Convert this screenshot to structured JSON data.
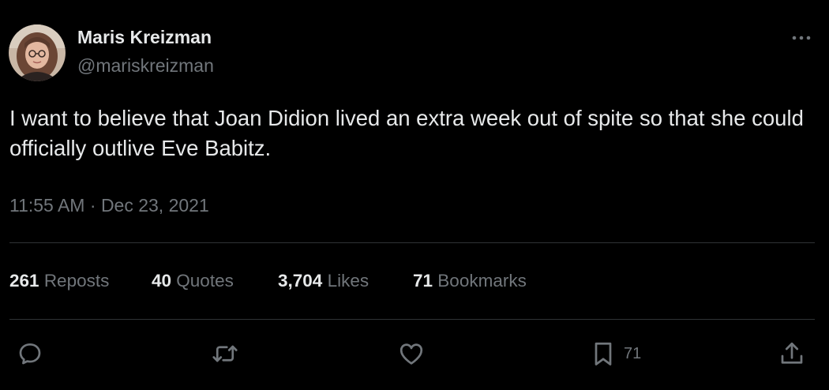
{
  "tweet": {
    "author": {
      "name": "Maris Kreizman",
      "handle": "@mariskreizman"
    },
    "text": "I want to believe that Joan Didion lived an extra week out of spite so that she could officially outlive Eve Babitz.",
    "time": "11:55 AM",
    "separator": "·",
    "date": "Dec 23, 2021"
  },
  "stats": [
    {
      "value": "261",
      "label": "Reposts"
    },
    {
      "value": "40",
      "label": "Quotes"
    },
    {
      "value": "3,704",
      "label": "Likes"
    },
    {
      "value": "71",
      "label": "Bookmarks"
    }
  ],
  "actions": {
    "reply": {
      "icon": "reply-icon"
    },
    "repost": {
      "icon": "repost-icon"
    },
    "like": {
      "icon": "heart-icon"
    },
    "bookmark": {
      "icon": "bookmark-icon",
      "count": "71"
    },
    "share": {
      "icon": "share-icon"
    }
  },
  "colors": {
    "background": "#000000",
    "primary_text": "#e7e9ea",
    "secondary_text": "#71767b",
    "divider": "#2f3336"
  }
}
